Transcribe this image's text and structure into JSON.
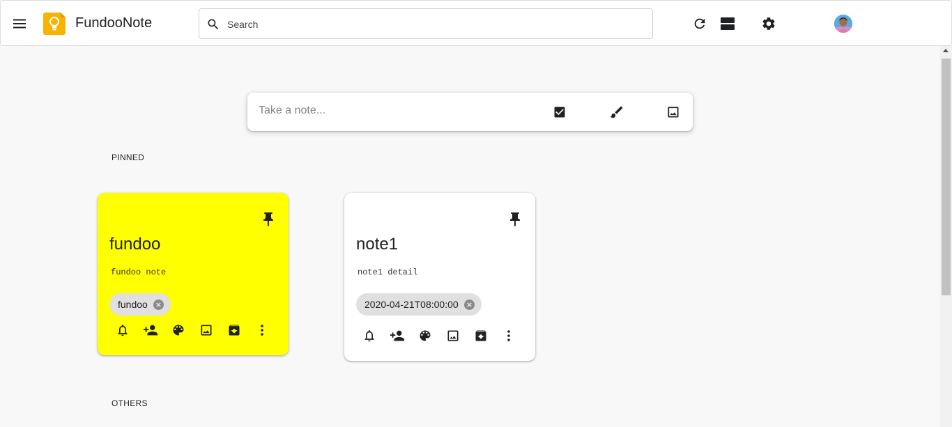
{
  "header": {
    "title": "FundooNote",
    "search_placeholder": "Search"
  },
  "take_note": {
    "placeholder": "Take a note..."
  },
  "sections": {
    "pinned_label": "PINNED",
    "others_label": "OTHERS"
  },
  "notes": [
    {
      "title": "fundoo",
      "body": "fundoo note",
      "chip": "fundoo",
      "color": "#ffff00"
    },
    {
      "title": "note1",
      "body": "note1 detail",
      "chip": "2020-04-21T08:00:00",
      "color": "#ffffff"
    }
  ],
  "icons": {
    "menu": "menu-icon",
    "logo": "lightbulb-logo-icon",
    "search": "search-icon",
    "refresh": "refresh-icon",
    "view": "list-view-icon",
    "settings": "gear-icon",
    "new_list": "checkbox-icon",
    "new_drawing": "brush-icon",
    "new_image": "image-icon",
    "note_actions": [
      "bell-icon",
      "add-person-icon",
      "palette-icon",
      "image-icon",
      "archive-icon",
      "more-vert-icon"
    ]
  },
  "colors": {
    "accent_logo": "#f6b400",
    "note_yellow": "#ffff00"
  }
}
